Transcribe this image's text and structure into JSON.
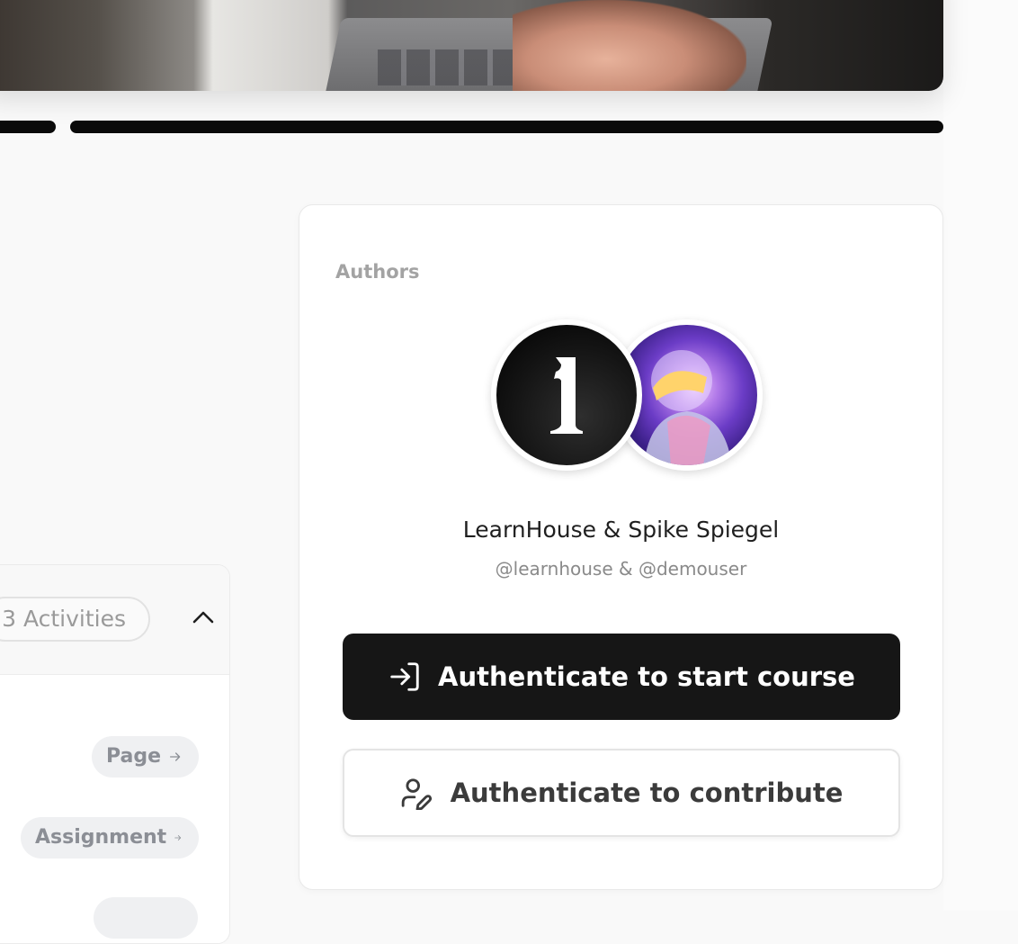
{
  "chapter": {
    "activities_count": "3 Activities",
    "activities": [
      {
        "type": "Page"
      },
      {
        "type": "Assignment"
      }
    ]
  },
  "authors": {
    "label": "Authors",
    "names": "LearnHouse & Spike Spiegel",
    "handles": "@learnhouse & @demouser"
  },
  "actions": {
    "start_label": "Authenticate to start course",
    "contribute_label": "Authenticate to contribute"
  },
  "colors": {
    "primary_button": "#161616",
    "background": "#f9f9f9",
    "tag_background": "#eff0f2"
  }
}
